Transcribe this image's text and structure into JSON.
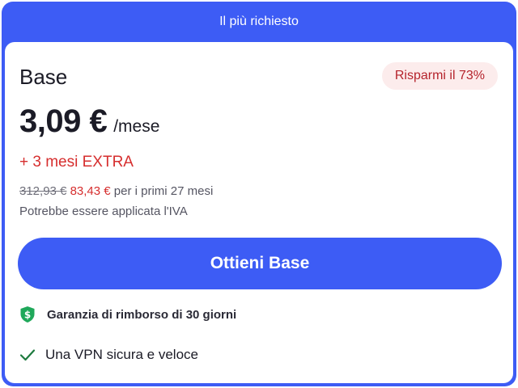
{
  "banner": {
    "label": "Il più richiesto"
  },
  "plan": {
    "name": "Base",
    "savings_badge": "Risparmi il 73%",
    "price": "3,09 €",
    "period": "/mese",
    "extra": "+ 3 mesi EXTRA",
    "old_price": "312,93 €",
    "new_price": "83,43 €",
    "price_period_text": "per i primi 27 mesi",
    "vat_note": "Potrebbe essere applicata l'IVA"
  },
  "cta": {
    "label": "Ottieni Base"
  },
  "features": {
    "guarantee": {
      "icon": "shield-dollar-icon",
      "label": "Garanzia di rimborso di 30 giorni"
    },
    "vpn": {
      "icon": "checkmark-icon",
      "label": "Una VPN sicura e veloce"
    }
  },
  "colors": {
    "accent": "#3d5cf5",
    "badge_background": "#fcecec",
    "badge_text": "#b5232c",
    "promo_red": "#d62e2e",
    "guarantee_green": "#1fa85a",
    "check_green": "#1d7a3e"
  }
}
